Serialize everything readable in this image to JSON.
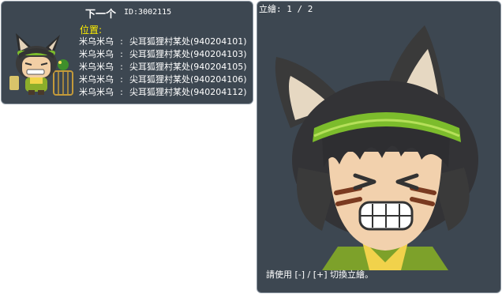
{
  "npc": {
    "name": "下一个",
    "id_text": "ID:3002115",
    "location_label": "位置:",
    "locations": [
      {
        "npc_name": "米乌米乌",
        "separator": ":",
        "place": "尖耳狐狸村某处(940204101)"
      },
      {
        "npc_name": "米乌米乌",
        "separator": ":",
        "place": "尖耳狐狸村某处(940204103)"
      },
      {
        "npc_name": "米乌米乌",
        "separator": ":",
        "place": "尖耳狐狸村某处(940204105)"
      },
      {
        "npc_name": "米乌米乌",
        "separator": ":",
        "place": "尖耳狐狸村某处(940204106)"
      },
      {
        "npc_name": "米乌米乌",
        "separator": ":",
        "place": "尖耳狐狸村某处(940204112)"
      }
    ]
  },
  "portrait": {
    "counter": "立繪: 1 / 2",
    "hint": "請使用 [-] / [+] 切換立繪。"
  },
  "colors": {
    "panel_bg": "#3d4751",
    "panel_border": "#8a95a0",
    "highlight_text": "#ffef00",
    "headband": "#7cbc2c"
  }
}
